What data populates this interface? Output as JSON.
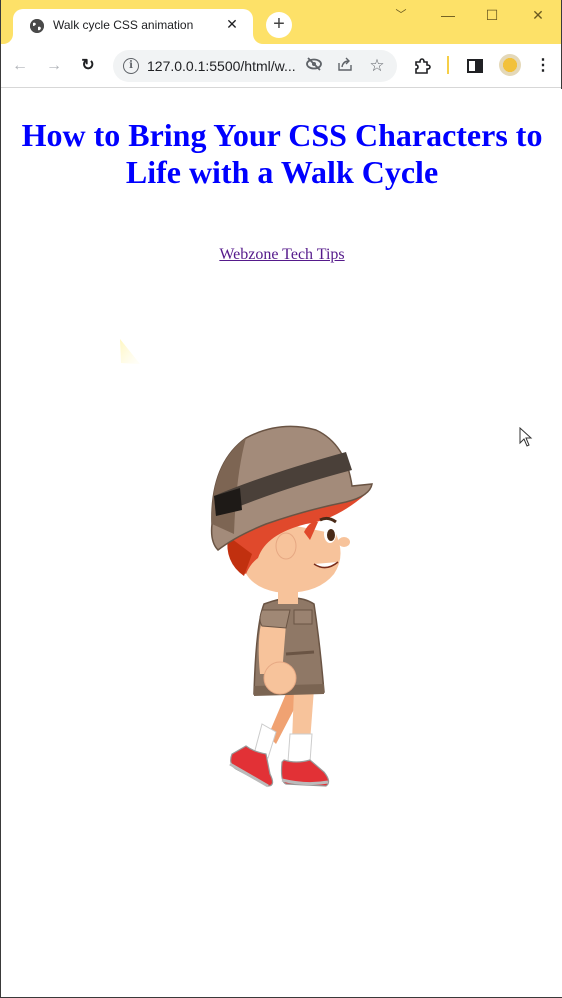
{
  "browser": {
    "tab": {
      "title": "Walk cycle CSS animation",
      "favicon": "globe-icon",
      "close_icon": "close-icon"
    },
    "new_tab_icon": "plus-icon",
    "window_controls": {
      "tab_search": "chevron-down-icon",
      "minimize": "minimize-icon",
      "maximize": "maximize-icon",
      "close": "close-icon"
    },
    "toolbar": {
      "back": "arrow-left-icon",
      "forward": "arrow-right-icon",
      "reload": "reload-icon",
      "url": "127.0.0.1:5500/html/w...",
      "site_info": "info-icon",
      "omnibox_icons": [
        "eye-off-icon",
        "share-icon",
        "star-icon"
      ],
      "extensions": "puzzle-icon",
      "side_panel": "side-panel-icon",
      "profile": "profile-avatar",
      "menu": "kebab-menu-icon"
    },
    "accent_color": "#fde168"
  },
  "page": {
    "heading_line1": "How to Bring Your CSS Characters to",
    "heading_line2": "Life with a Walk Cycle",
    "heading_color": "#0000ff",
    "link_text": "Webzone Tech Tips",
    "link_color": "#551a8b",
    "character": "walking-boy-explorer"
  }
}
